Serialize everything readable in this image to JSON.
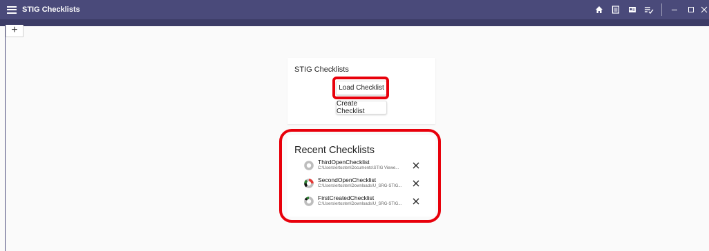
{
  "app": {
    "title": "STIG Checklists",
    "accent": "#4a4a7a",
    "tabbar_color": "#3c3c66",
    "highlight_color": "#e8000b"
  },
  "titlebar": {
    "icons": [
      "home-icon",
      "document-icon",
      "id-card-icon",
      "checklist-icon"
    ],
    "window_controls": [
      "minimize-icon",
      "maximize-icon",
      "close-icon"
    ]
  },
  "tabs": {
    "add_label": "+"
  },
  "card": {
    "title": "STIG Checklists",
    "load_label": "Load Checklist",
    "create_label": "Create Checklist"
  },
  "recent": {
    "title": "Recent Checklists",
    "items": [
      {
        "name": "ThirdOpenChecklist",
        "path": "C:\\Users\\ertosten\\Documents\\STIG Viewe...",
        "status": "empty"
      },
      {
        "name": "SecondOpenChecklist",
        "path": "C:\\Users\\ertosten\\Downloads\\U_SRG-STIG...",
        "status": "mixed"
      },
      {
        "name": "FirstCreatedChecklist",
        "path": "C:\\Users\\ertosten\\Downloads\\U_SRG-STIG...",
        "status": "partial"
      }
    ]
  }
}
